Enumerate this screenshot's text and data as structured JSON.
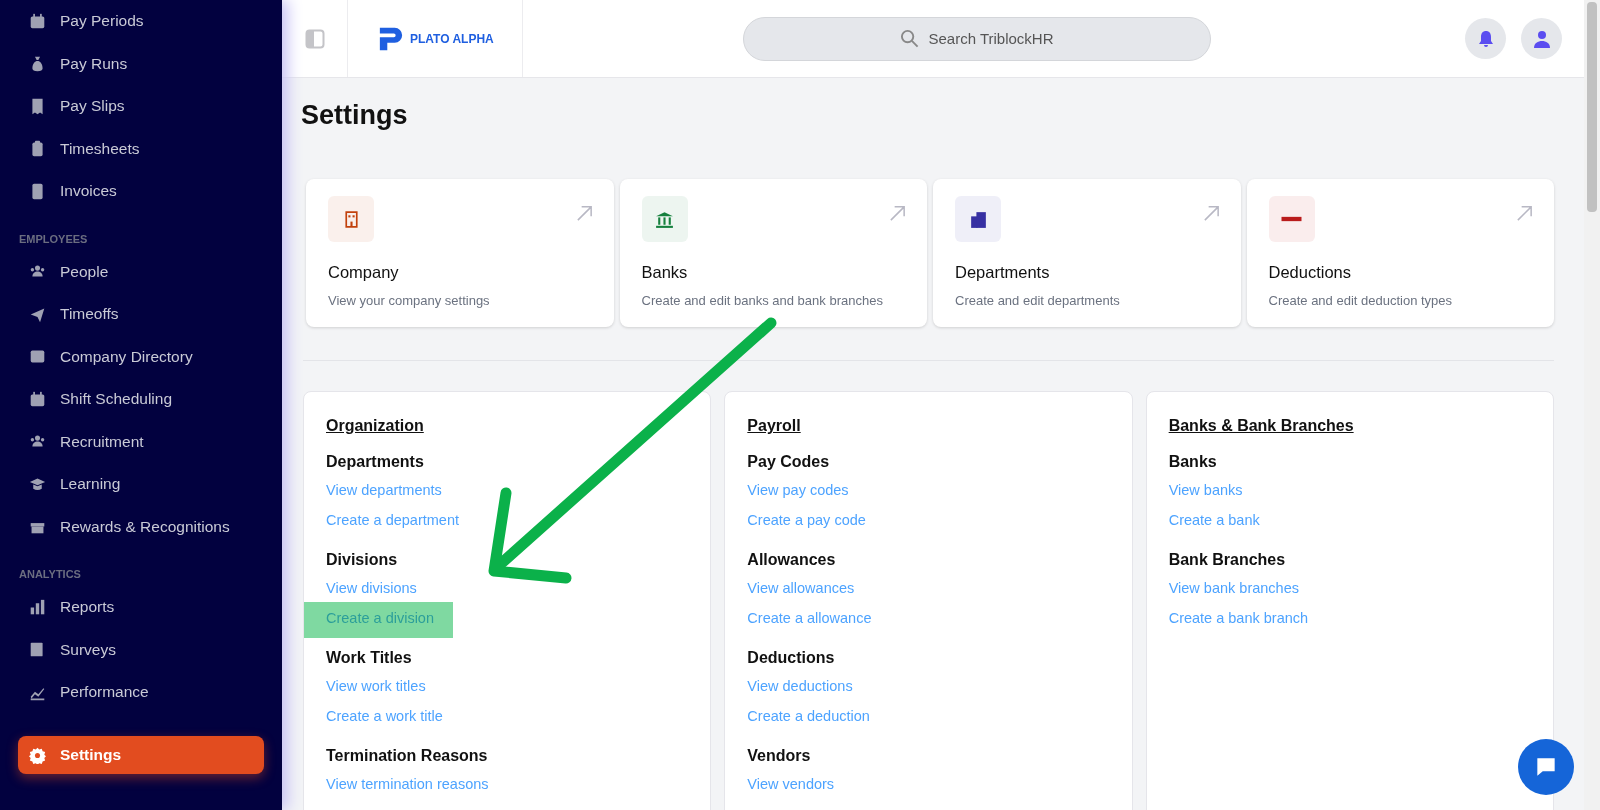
{
  "sidebar": {
    "groups": [
      {
        "items": [
          {
            "label": "Pay Periods",
            "selected": false
          },
          {
            "label": "Pay Runs",
            "selected": false
          },
          {
            "label": "Pay Slips",
            "selected": false
          },
          {
            "label": "Timesheets",
            "selected": false
          },
          {
            "label": "Invoices",
            "selected": false
          }
        ]
      },
      {
        "heading": "EMPLOYEES",
        "items": [
          {
            "label": "People",
            "selected": false
          },
          {
            "label": "Timeoffs",
            "selected": false
          },
          {
            "label": "Company Directory",
            "selected": false
          },
          {
            "label": "Shift Scheduling",
            "selected": false
          },
          {
            "label": "Recruitment",
            "selected": false
          },
          {
            "label": "Learning",
            "selected": false
          },
          {
            "label": "Rewards & Recognitions",
            "selected": false
          }
        ]
      },
      {
        "heading": "ANALYTICS",
        "items": [
          {
            "label": "Reports",
            "selected": false
          },
          {
            "label": "Surveys",
            "selected": false
          },
          {
            "label": "Performance",
            "selected": false
          }
        ]
      }
    ],
    "bottom": {
      "label": "Settings",
      "selected": true
    }
  },
  "topbar": {
    "logo": "PLATO ALPHA",
    "search": {
      "placeholder": "Search TriblockHR"
    }
  },
  "page": {
    "title": "Settings"
  },
  "cards": [
    {
      "title": "Company",
      "description": "View your company settings",
      "color": "#c2410c"
    },
    {
      "title": "Banks",
      "description": "Create and edit banks and bank branches",
      "color": "#15803d"
    },
    {
      "title": "Departments",
      "description": "Create and edit departments",
      "color": "#3730a3"
    },
    {
      "title": "Deductions",
      "description": "Create and edit deduction types",
      "color": "#b91c1c"
    }
  ],
  "sections": [
    {
      "title": "Organization",
      "groups": [
        {
          "heading": "Departments",
          "links": [
            {
              "label": "View departments",
              "highlighted": false
            },
            {
              "label": "Create a department",
              "highlighted": false
            }
          ]
        },
        {
          "heading": "Divisions",
          "links": [
            {
              "label": "View divisions",
              "highlighted": false
            },
            {
              "label": "Create a division",
              "highlighted": true
            }
          ]
        },
        {
          "heading": "Work Titles",
          "links": [
            {
              "label": "View work titles",
              "highlighted": false
            },
            {
              "label": "Create a work title",
              "highlighted": false
            }
          ]
        },
        {
          "heading": "Termination Reasons",
          "links": [
            {
              "label": "View termination reasons",
              "highlighted": false
            }
          ]
        }
      ]
    },
    {
      "title": "Payroll",
      "groups": [
        {
          "heading": "Pay Codes",
          "links": [
            {
              "label": "View pay codes",
              "highlighted": false
            },
            {
              "label": "Create a pay code",
              "highlighted": false
            }
          ]
        },
        {
          "heading": "Allowances",
          "links": [
            {
              "label": "View allowances",
              "highlighted": false
            },
            {
              "label": "Create a allowance",
              "highlighted": false
            }
          ]
        },
        {
          "heading": "Deductions",
          "links": [
            {
              "label": "View deductions",
              "highlighted": false
            },
            {
              "label": "Create a deduction",
              "highlighted": false
            }
          ]
        },
        {
          "heading": "Vendors",
          "links": [
            {
              "label": "View vendors",
              "highlighted": false
            }
          ]
        }
      ]
    },
    {
      "title": "Banks & Bank Branches",
      "groups": [
        {
          "heading": "Banks",
          "links": [
            {
              "label": "View banks",
              "highlighted": false
            },
            {
              "label": "Create a bank",
              "highlighted": false
            }
          ]
        },
        {
          "heading": "Bank Branches",
          "links": [
            {
              "label": "View bank branches",
              "highlighted": false
            },
            {
              "label": "Create a bank branch",
              "highlighted": false
            }
          ]
        }
      ]
    }
  ]
}
